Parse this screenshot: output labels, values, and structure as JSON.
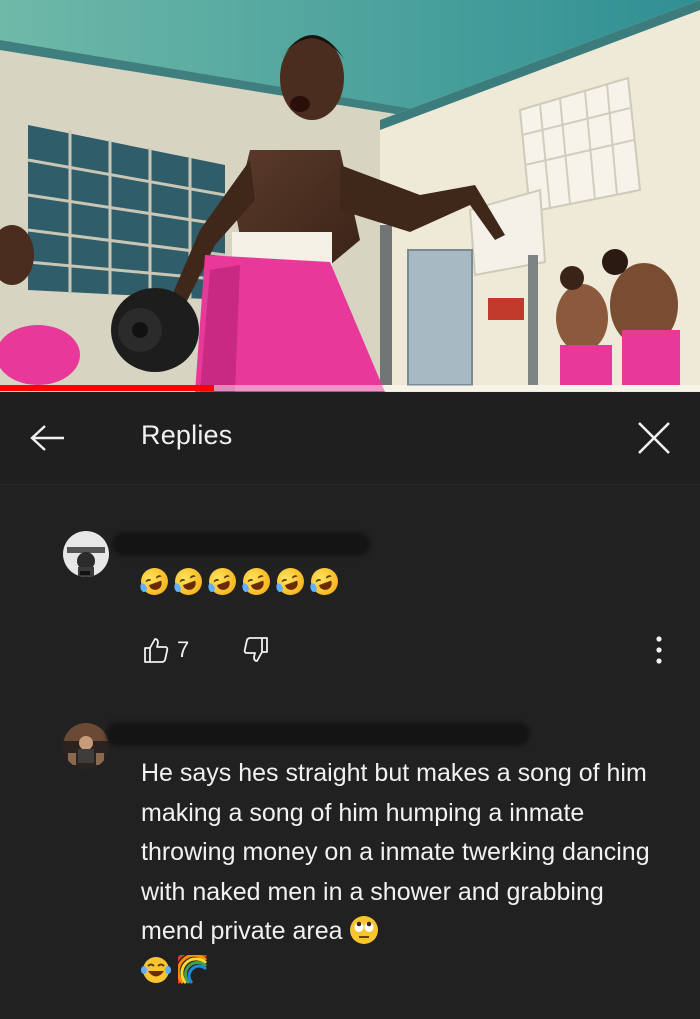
{
  "video": {
    "progress": 0.305,
    "colors": {
      "progress": "#ff0000",
      "wall": "#e9e3d2",
      "sky": "#49a89a",
      "pants": "#e8399a"
    }
  },
  "header": {
    "back_icon": "arrow-left-icon",
    "title": "Replies",
    "close_icon": "close-icon"
  },
  "comments": [
    {
      "author_redacted": true,
      "avatar_icon": "profile-photo",
      "emoji_text": "🤣🤣🤣🤣🤣🤣",
      "likes": "7",
      "like_icon": "thumbs-up-icon",
      "dislike_icon": "thumbs-down-icon",
      "more_icon": "more-vertical-icon"
    },
    {
      "author_redacted": true,
      "avatar_icon": "profile-photo",
      "text": "He says hes straight but makes a song of him making a song of him humping a inmate throwing money on a inmate twerking dancing with naked men in a shower and grabbing mend private area",
      "trailing_emojis": [
        "eye-roll-emoji",
        "laughing-tears-emoji",
        "rainbow-emoji"
      ]
    }
  ]
}
